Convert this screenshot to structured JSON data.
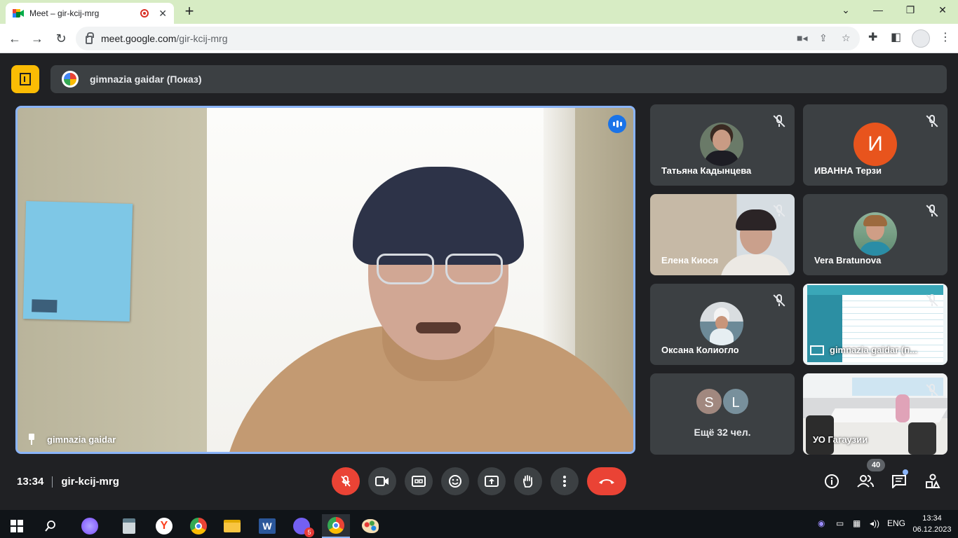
{
  "browser": {
    "tab_title": "Meet – gir-kcij-mrg",
    "url_host": "meet.google.com",
    "url_path": "/gir-kcij-mrg",
    "window_controls": [
      "chevron-down",
      "minimize",
      "restore",
      "close"
    ]
  },
  "meet": {
    "presenting_banner": "gimnazia gaidar (Показ)",
    "main_tile_name": "gimnazia gaidar",
    "tiles": [
      {
        "name": "Татьяна Кадынцева",
        "kind": "photo",
        "muted": true
      },
      {
        "name": "ИВАННА Терзи",
        "kind": "letter",
        "letter": "И",
        "color": "#e8541d",
        "muted": true
      },
      {
        "name": "Елена Киося",
        "kind": "video",
        "muted": true
      },
      {
        "name": "Vera Bratunova",
        "kind": "photo",
        "muted": true
      },
      {
        "name": "Оксана Колиогло",
        "kind": "photo",
        "muted": true
      },
      {
        "name": "gimnazia gaidar (п...",
        "kind": "presentation",
        "muted": true
      },
      {
        "name": "Ещё 32 чел.",
        "kind": "more",
        "avatars": [
          "S",
          "L"
        ]
      },
      {
        "name": "УО Гагаузии",
        "kind": "video",
        "muted": true
      }
    ],
    "time": "13:34",
    "meeting_code": "gir-kcij-mrg",
    "participants_count": "40",
    "accent": "#8ab4f8",
    "danger": "#ea4335"
  },
  "taskbar": {
    "language": "ENG",
    "time": "13:34",
    "date": "06.12.2023",
    "viber_badge": "5"
  }
}
